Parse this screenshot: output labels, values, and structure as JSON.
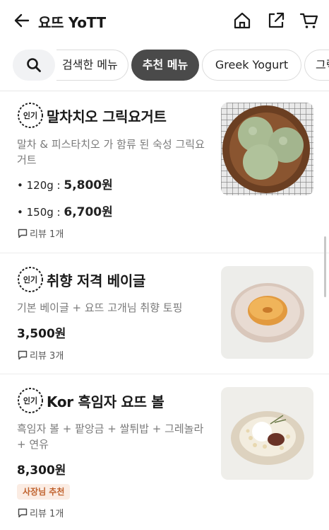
{
  "header": {
    "title": "요뜨 YoTT",
    "icons": [
      "back-arrow-icon",
      "home-icon",
      "share-icon",
      "cart-icon"
    ]
  },
  "chips": {
    "search_icon": "search-icon",
    "items": [
      {
        "label": "검색한 메뉴",
        "selected": false
      },
      {
        "label": "추천 메뉴",
        "selected": true
      },
      {
        "label": "Greek Yogurt",
        "selected": false
      },
      {
        "label": "그릭",
        "selected": false
      }
    ]
  },
  "badge_label": "인기",
  "menu_items": [
    {
      "name": "말차치오 그릭요거트",
      "description": "말차 & 피스타치오 가 함류 된 숙성 그릭요거트",
      "prices": [
        {
          "size": "• 120g : ",
          "price": "5,800원"
        },
        {
          "size": "• 150g : ",
          "price": "6,700원"
        }
      ],
      "review": "리뷰 1개"
    },
    {
      "name": "취향 저격 베이글",
      "description": "기본 베이글 + 요뜨 고개님 취향 토핑",
      "price": "3,500원",
      "review": "리뷰 3개"
    },
    {
      "name": "Kor 흑임자 요뜨 볼",
      "description": "흑임자 볼 + 팥앙금 + 쌀튀밥 + 그레놀라 + 연유",
      "price": "8,300원",
      "tag": "사장님 추천",
      "review": "리뷰 1개"
    }
  ],
  "colors": {
    "selected_chip": "#4a4a4a",
    "owner_tag_bg": "#fbece3",
    "owner_tag_text": "#c0622d"
  }
}
